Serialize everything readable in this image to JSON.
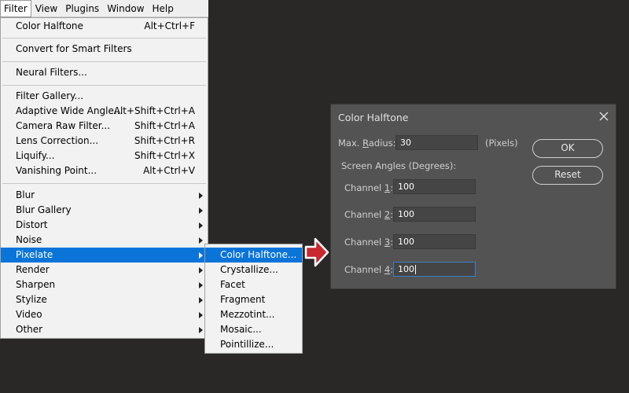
{
  "menubar": {
    "items": [
      {
        "label": "Filter",
        "active": true
      },
      {
        "label": "View"
      },
      {
        "label": "Plugins"
      },
      {
        "label": "Window"
      },
      {
        "label": "Help"
      }
    ]
  },
  "filter_menu": {
    "last_filter": {
      "label": "Color Halftone",
      "shortcut": "Alt+Ctrl+F"
    },
    "smart_filters": "Convert for Smart Filters",
    "neural_filters": "Neural Filters...",
    "gallery": [
      {
        "label": "Filter Gallery...",
        "shortcut": ""
      },
      {
        "label": "Adaptive Wide Angle...",
        "shortcut": "Alt+Shift+Ctrl+A"
      },
      {
        "label": "Camera Raw Filter...",
        "shortcut": "Shift+Ctrl+A"
      },
      {
        "label": "Lens Correction...",
        "shortcut": "Shift+Ctrl+R"
      },
      {
        "label": "Liquify...",
        "shortcut": "Shift+Ctrl+X"
      },
      {
        "label": "Vanishing Point...",
        "shortcut": "Alt+Ctrl+V"
      }
    ],
    "groups": [
      "Blur",
      "Blur Gallery",
      "Distort",
      "Noise",
      "Pixelate",
      "Render",
      "Sharpen",
      "Stylize",
      "Video",
      "Other"
    ],
    "highlighted_group": "Pixelate"
  },
  "pixelate_submenu": {
    "items": [
      "Color Halftone...",
      "Crystallize...",
      "Facet",
      "Fragment",
      "Mezzotint...",
      "Mosaic...",
      "Pointillize..."
    ],
    "highlighted": "Color Halftone..."
  },
  "dialog": {
    "title": "Color Halftone",
    "max_radius": {
      "label_prefix": "Max. ",
      "label_key": "R",
      "label_suffix": "adius:",
      "value": "30",
      "unit": "(Pixels)"
    },
    "screen_angles_label": "Screen Angles (Degrees):",
    "channels": [
      {
        "label_prefix": "Channel ",
        "key": "1",
        "value": "100"
      },
      {
        "label_prefix": "Channel ",
        "key": "2",
        "value": "100"
      },
      {
        "label_prefix": "Channel ",
        "key": "3",
        "value": "100"
      },
      {
        "label_prefix": "Channel ",
        "key": "4",
        "value": "100"
      }
    ],
    "ok_label": "OK",
    "reset_label": "Reset"
  },
  "colors": {
    "background": "#2a2827",
    "menu_highlight": "#0a74d9",
    "dialog_bg": "#535353",
    "arrow_red": "#c8282e"
  },
  "icons": [
    "close-icon",
    "submenu-arrow-icon",
    "red-arrow-icon"
  ]
}
